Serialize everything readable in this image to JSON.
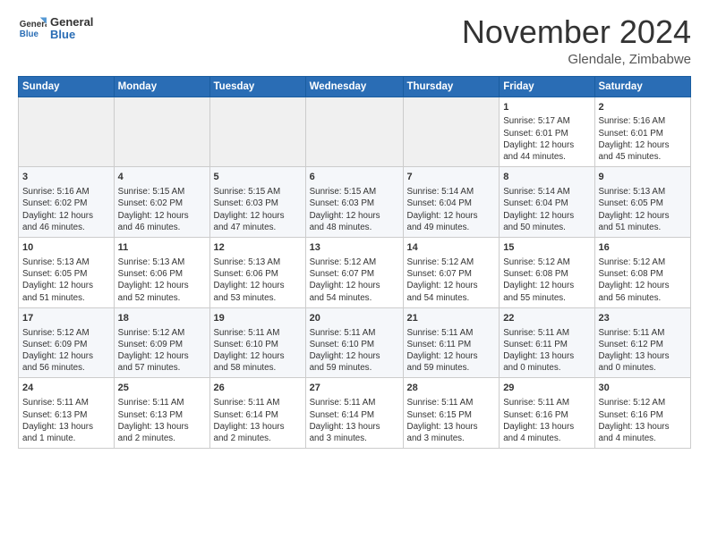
{
  "header": {
    "logo": {
      "general": "General",
      "blue": "Blue"
    },
    "title": "November 2024",
    "location": "Glendale, Zimbabwe"
  },
  "weekdays": [
    "Sunday",
    "Monday",
    "Tuesday",
    "Wednesday",
    "Thursday",
    "Friday",
    "Saturday"
  ],
  "weeks": [
    [
      {
        "day": "",
        "info": ""
      },
      {
        "day": "",
        "info": ""
      },
      {
        "day": "",
        "info": ""
      },
      {
        "day": "",
        "info": ""
      },
      {
        "day": "",
        "info": ""
      },
      {
        "day": "1",
        "info": "Sunrise: 5:17 AM\nSunset: 6:01 PM\nDaylight: 12 hours\nand 44 minutes."
      },
      {
        "day": "2",
        "info": "Sunrise: 5:16 AM\nSunset: 6:01 PM\nDaylight: 12 hours\nand 45 minutes."
      }
    ],
    [
      {
        "day": "3",
        "info": "Sunrise: 5:16 AM\nSunset: 6:02 PM\nDaylight: 12 hours\nand 46 minutes."
      },
      {
        "day": "4",
        "info": "Sunrise: 5:15 AM\nSunset: 6:02 PM\nDaylight: 12 hours\nand 46 minutes."
      },
      {
        "day": "5",
        "info": "Sunrise: 5:15 AM\nSunset: 6:03 PM\nDaylight: 12 hours\nand 47 minutes."
      },
      {
        "day": "6",
        "info": "Sunrise: 5:15 AM\nSunset: 6:03 PM\nDaylight: 12 hours\nand 48 minutes."
      },
      {
        "day": "7",
        "info": "Sunrise: 5:14 AM\nSunset: 6:04 PM\nDaylight: 12 hours\nand 49 minutes."
      },
      {
        "day": "8",
        "info": "Sunrise: 5:14 AM\nSunset: 6:04 PM\nDaylight: 12 hours\nand 50 minutes."
      },
      {
        "day": "9",
        "info": "Sunrise: 5:13 AM\nSunset: 6:05 PM\nDaylight: 12 hours\nand 51 minutes."
      }
    ],
    [
      {
        "day": "10",
        "info": "Sunrise: 5:13 AM\nSunset: 6:05 PM\nDaylight: 12 hours\nand 51 minutes."
      },
      {
        "day": "11",
        "info": "Sunrise: 5:13 AM\nSunset: 6:06 PM\nDaylight: 12 hours\nand 52 minutes."
      },
      {
        "day": "12",
        "info": "Sunrise: 5:13 AM\nSunset: 6:06 PM\nDaylight: 12 hours\nand 53 minutes."
      },
      {
        "day": "13",
        "info": "Sunrise: 5:12 AM\nSunset: 6:07 PM\nDaylight: 12 hours\nand 54 minutes."
      },
      {
        "day": "14",
        "info": "Sunrise: 5:12 AM\nSunset: 6:07 PM\nDaylight: 12 hours\nand 54 minutes."
      },
      {
        "day": "15",
        "info": "Sunrise: 5:12 AM\nSunset: 6:08 PM\nDaylight: 12 hours\nand 55 minutes."
      },
      {
        "day": "16",
        "info": "Sunrise: 5:12 AM\nSunset: 6:08 PM\nDaylight: 12 hours\nand 56 minutes."
      }
    ],
    [
      {
        "day": "17",
        "info": "Sunrise: 5:12 AM\nSunset: 6:09 PM\nDaylight: 12 hours\nand 56 minutes."
      },
      {
        "day": "18",
        "info": "Sunrise: 5:12 AM\nSunset: 6:09 PM\nDaylight: 12 hours\nand 57 minutes."
      },
      {
        "day": "19",
        "info": "Sunrise: 5:11 AM\nSunset: 6:10 PM\nDaylight: 12 hours\nand 58 minutes."
      },
      {
        "day": "20",
        "info": "Sunrise: 5:11 AM\nSunset: 6:10 PM\nDaylight: 12 hours\nand 59 minutes."
      },
      {
        "day": "21",
        "info": "Sunrise: 5:11 AM\nSunset: 6:11 PM\nDaylight: 12 hours\nand 59 minutes."
      },
      {
        "day": "22",
        "info": "Sunrise: 5:11 AM\nSunset: 6:11 PM\nDaylight: 13 hours\nand 0 minutes."
      },
      {
        "day": "23",
        "info": "Sunrise: 5:11 AM\nSunset: 6:12 PM\nDaylight: 13 hours\nand 0 minutes."
      }
    ],
    [
      {
        "day": "24",
        "info": "Sunrise: 5:11 AM\nSunset: 6:13 PM\nDaylight: 13 hours\nand 1 minute."
      },
      {
        "day": "25",
        "info": "Sunrise: 5:11 AM\nSunset: 6:13 PM\nDaylight: 13 hours\nand 2 minutes."
      },
      {
        "day": "26",
        "info": "Sunrise: 5:11 AM\nSunset: 6:14 PM\nDaylight: 13 hours\nand 2 minutes."
      },
      {
        "day": "27",
        "info": "Sunrise: 5:11 AM\nSunset: 6:14 PM\nDaylight: 13 hours\nand 3 minutes."
      },
      {
        "day": "28",
        "info": "Sunrise: 5:11 AM\nSunset: 6:15 PM\nDaylight: 13 hours\nand 3 minutes."
      },
      {
        "day": "29",
        "info": "Sunrise: 5:11 AM\nSunset: 6:16 PM\nDaylight: 13 hours\nand 4 minutes."
      },
      {
        "day": "30",
        "info": "Sunrise: 5:12 AM\nSunset: 6:16 PM\nDaylight: 13 hours\nand 4 minutes."
      }
    ]
  ]
}
